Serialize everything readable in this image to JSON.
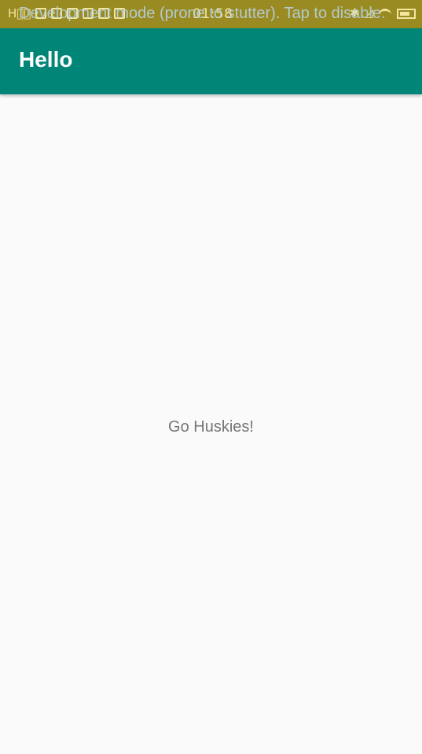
{
  "status_bar": {
    "time": "01:58",
    "left_icons": [
      "sim-icon",
      "usb-icon",
      "notification-icon",
      "notification-icon",
      "notification-icon",
      "notification-icon",
      "notification-icon",
      "notification-icon"
    ],
    "right_icons": [
      "bluetooth-icon",
      "no-signal-icon",
      "wifi-icon",
      "battery-icon"
    ],
    "color": "#9a8a22"
  },
  "overlay": {
    "text": "Development mode (prone to stutter). Tap to disable."
  },
  "app_bar": {
    "title": "Hello",
    "color": "#008577"
  },
  "main": {
    "message": "Go Huskies!"
  }
}
